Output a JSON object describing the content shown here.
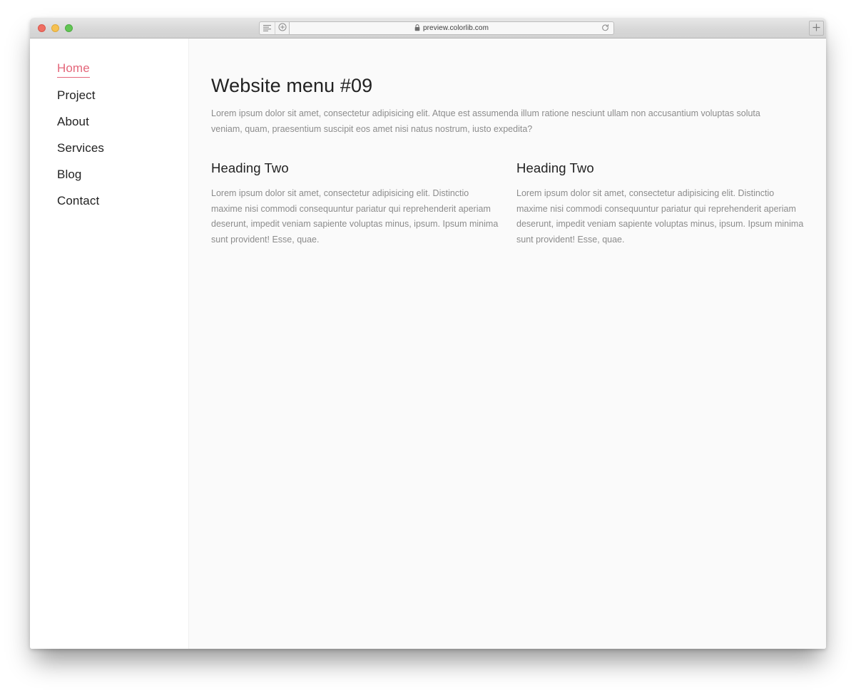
{
  "browser": {
    "traffic_lights": [
      "close",
      "minimize",
      "maximize"
    ],
    "toolbar_icons": {
      "sidebar_icon": "sidebar-icon",
      "tab_overview_icon": "tab-overview-icon",
      "reload_icon": "reload-icon",
      "new_tab_icon": "plus-icon",
      "lock_icon": "lock-icon"
    },
    "url": "preview.colorlib.com",
    "new_tab_label": "+"
  },
  "sidebar": {
    "items": [
      {
        "label": "Home",
        "active": true
      },
      {
        "label": "Project",
        "active": false
      },
      {
        "label": "About",
        "active": false
      },
      {
        "label": "Services",
        "active": false
      },
      {
        "label": "Blog",
        "active": false
      },
      {
        "label": "Contact",
        "active": false
      }
    ]
  },
  "main": {
    "title": "Website menu #09",
    "intro": "Lorem ipsum dolor sit amet, consectetur adipisicing elit. Atque est assumenda illum ratione nesciunt ullam non accusantium voluptas soluta veniam, quam, praesentium suscipit eos amet nisi natus nostrum, iusto expedita?",
    "columns": [
      {
        "heading": "Heading Two",
        "body": "Lorem ipsum dolor sit amet, consectetur adipisicing elit. Distinctio maxime nisi commodi consequuntur pariatur qui reprehenderit aperiam deserunt, impedit veniam sapiente voluptas minus, ipsum. Ipsum minima sunt provident! Esse, quae."
      },
      {
        "heading": "Heading Two",
        "body": "Lorem ipsum dolor sit amet, consectetur adipisicing elit. Distinctio maxime nisi commodi consequuntur pariatur qui reprehenderit aperiam deserunt, impedit veniam sapiente voluptas minus, ipsum. Ipsum minima sunt provident! Esse, quae."
      }
    ]
  },
  "colors": {
    "accent": "#e4667a",
    "text": "#222222",
    "muted_text": "#8c8c8c",
    "content_bg": "#fafafa",
    "sidebar_bg": "#ffffff",
    "traffic_red": "#ef6e62",
    "traffic_yellow": "#f6c151",
    "traffic_green": "#62c554"
  }
}
